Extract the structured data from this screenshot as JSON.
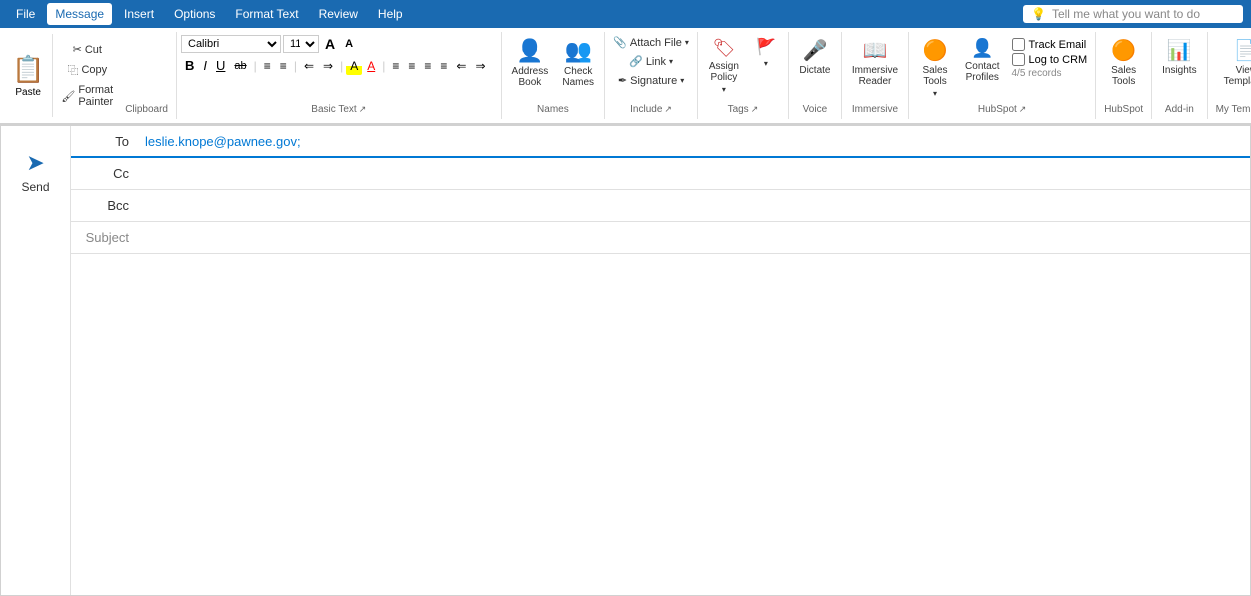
{
  "menubar": {
    "items": [
      {
        "label": "File",
        "active": false
      },
      {
        "label": "Message",
        "active": true
      },
      {
        "label": "Insert",
        "active": false
      },
      {
        "label": "Options",
        "active": false
      },
      {
        "label": "Format Text",
        "active": false
      },
      {
        "label": "Review",
        "active": false
      },
      {
        "label": "Help",
        "active": false
      }
    ],
    "search_placeholder": "Tell me what you want to do",
    "search_icon": "💡"
  },
  "ribbon": {
    "clipboard": {
      "label": "Clipboard",
      "paste_label": "Paste",
      "cut_label": "Cut",
      "copy_label": "Copy",
      "format_painter_label": "Format Painter"
    },
    "basictext": {
      "label": "Basic Text",
      "font_name": "Calibri",
      "font_size": "11",
      "grow_label": "A",
      "shrink_label": "A",
      "bold_label": "B",
      "italic_label": "I",
      "underline_label": "U",
      "strikethrough_label": "ab",
      "bullets_label": "≡",
      "numbering_label": "≡",
      "decrease_indent": "⇐",
      "increase_indent": "⇒",
      "highlight_label": "A",
      "font_color_label": "A",
      "align_left": "≡",
      "align_center": "≡",
      "align_right": "≡",
      "justify": "≡",
      "decrease_indent2": "⇐",
      "increase_indent2": "⇒"
    },
    "names": {
      "label": "Names",
      "address_book_label": "Address\nBook",
      "check_names_label": "Check\nNames"
    },
    "include": {
      "label": "Include",
      "attach_file_label": "Attach File",
      "link_label": "Link",
      "signature_label": "Signature"
    },
    "tags": {
      "label": "Tags",
      "assign_policy_label": "Assign\nPolicy",
      "flag_label": ""
    },
    "voice": {
      "label": "Voice",
      "dictate_label": "Dictate"
    },
    "immersive": {
      "label": "Immersive",
      "reader_label": "Immersive\nReader"
    },
    "hubspot": {
      "label": "HubSpot",
      "sales_tools_label": "Sales\nTools",
      "contact_profiles_label": "Contact\nProfiles",
      "track_email_label": "Track Email",
      "log_to_crm_label": "Log to CRM",
      "records_text": "4/5 records"
    },
    "hubspot2": {
      "label": "HubSpot",
      "sales_tools_label": "Sales\nTools"
    },
    "addin": {
      "label": "Add-in",
      "insights_label": "Insights"
    },
    "mytemplates": {
      "label": "My Templates",
      "view_templates_label": "View\nTemplates"
    }
  },
  "compose": {
    "to_label": "To",
    "to_value": "leslie.knope@pawnee.gov;",
    "cc_label": "Cc",
    "bcc_label": "Bcc",
    "subject_label": "Subject",
    "subject_placeholder": "",
    "send_label": "Send"
  }
}
